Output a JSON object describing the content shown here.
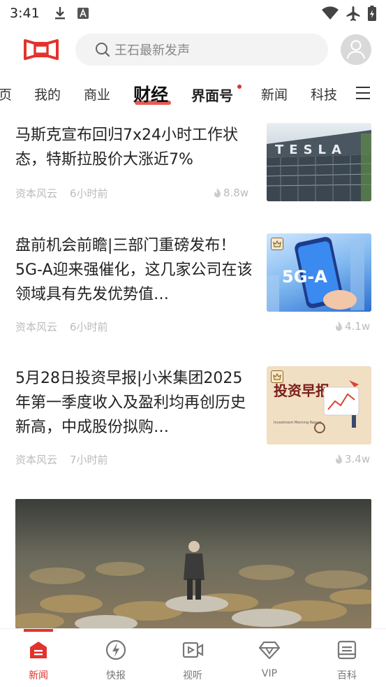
{
  "status_bar": {
    "time": "3:41"
  },
  "search": {
    "placeholder": "王石最新发声"
  },
  "tabs": [
    {
      "label": "页"
    },
    {
      "label": "我的"
    },
    {
      "label": "商业"
    },
    {
      "label": "财经"
    },
    {
      "label": "界面号"
    },
    {
      "label": "新闻"
    },
    {
      "label": "科技"
    }
  ],
  "articles": [
    {
      "title": "马斯克宣布回归7x24小时工作状态，特斯拉股价大涨近7%",
      "source": "资本风云",
      "time": "6小时前",
      "views": "8.8w",
      "thumb_text": "TESLA"
    },
    {
      "title": "盘前机会前瞻|三部门重磅发布！5G-A迎来强催化，这几家公司在该领域具有先发优势值…",
      "source": "资本风云",
      "time": "6小时前",
      "views": "4.1w",
      "thumb_text": "5G-A"
    },
    {
      "title": "5月28日投资早报|小米集团2025年第一季度收入及盈利均再创历史新高，中成股份拟购…",
      "source": "资本风云",
      "time": "7小时前",
      "views": "3.4w",
      "thumb_text": "投资早报",
      "thumb_sub": "Investment Morning Report"
    }
  ],
  "bottom_nav": [
    {
      "label": "新闻",
      "icon": "news-icon",
      "active": true
    },
    {
      "label": "快报",
      "icon": "flash-icon"
    },
    {
      "label": "视听",
      "icon": "video-icon"
    },
    {
      "label": "VIP",
      "icon": "vip-diamond-icon"
    },
    {
      "label": "百科",
      "icon": "encyclopedia-icon"
    }
  ],
  "colors": {
    "accent": "#e2322d",
    "muted": "#bbbbbb"
  }
}
